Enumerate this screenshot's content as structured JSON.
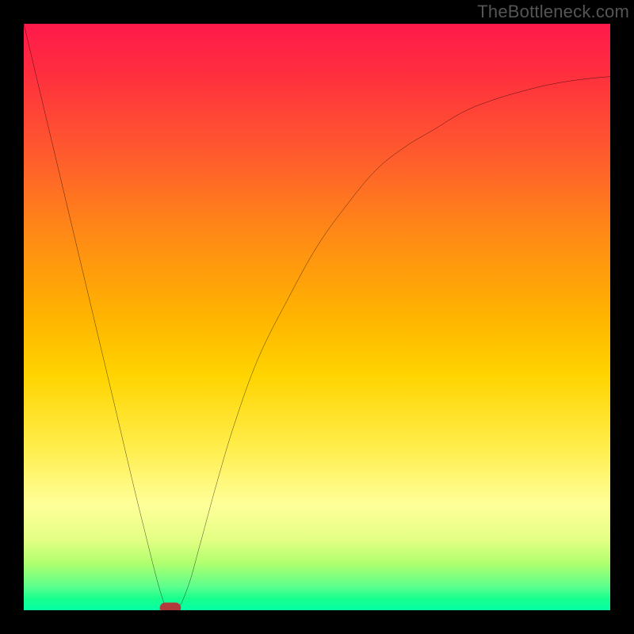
{
  "watermark": "TheBottleneck.com",
  "chart_data": {
    "type": "line",
    "title": "",
    "xlabel": "",
    "ylabel": "",
    "xlim": [
      0,
      100
    ],
    "ylim": [
      0,
      100
    ],
    "grid": false,
    "legend": false,
    "series": [
      {
        "name": "curve",
        "x": [
          0,
          5,
          10,
          15,
          20,
          24,
          26,
          28,
          30,
          33,
          36,
          40,
          45,
          50,
          55,
          60,
          65,
          70,
          75,
          80,
          85,
          90,
          95,
          100
        ],
        "y": [
          100,
          79,
          58,
          37,
          16,
          1,
          0,
          4,
          11,
          22,
          32,
          43,
          53,
          62,
          69,
          75,
          79,
          82,
          85,
          87,
          88.5,
          89.7,
          90.5,
          91
        ]
      }
    ],
    "marker": {
      "x": 25,
      "y": 0,
      "shape": "pill",
      "color": "#b33a3a"
    }
  }
}
